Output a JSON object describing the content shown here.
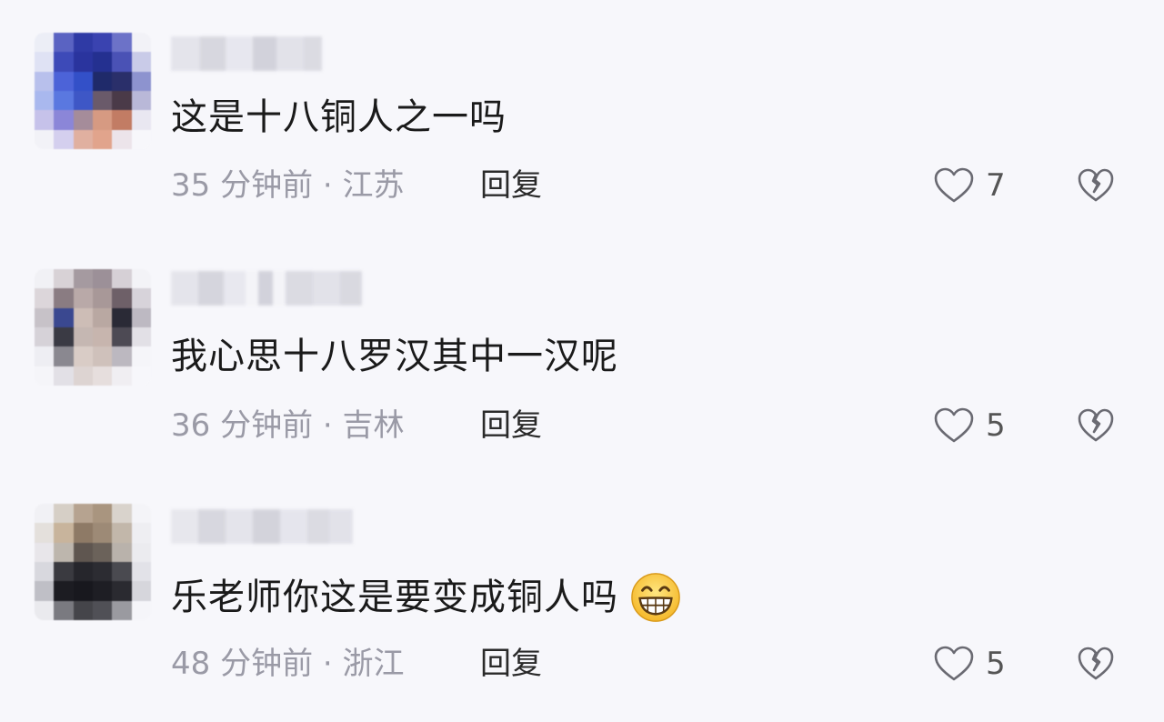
{
  "comments": [
    {
      "text": "这是十八铜人之一吗",
      "time": "35 分钟前",
      "location": "江苏",
      "reply_label": "回复",
      "likes": "7"
    },
    {
      "text": "我心思十八罗汉其中一汉呢",
      "time": "36 分钟前",
      "location": "吉林",
      "reply_label": "回复",
      "likes": "5"
    },
    {
      "text": "乐老师你这是要变成铜人吗",
      "time": "48 分钟前",
      "location": "浙江",
      "reply_label": "回复",
      "likes": "5"
    }
  ],
  "meta_separator": " · ",
  "icons": {
    "like": "heart-outline-icon",
    "dislike": "broken-heart-icon",
    "emoji": "grinning-face-icon"
  },
  "colors": {
    "background": "#f7f7fb",
    "text": "#1a1a1a",
    "meta": "#9a9aa6",
    "icon": "#6a6a72"
  }
}
